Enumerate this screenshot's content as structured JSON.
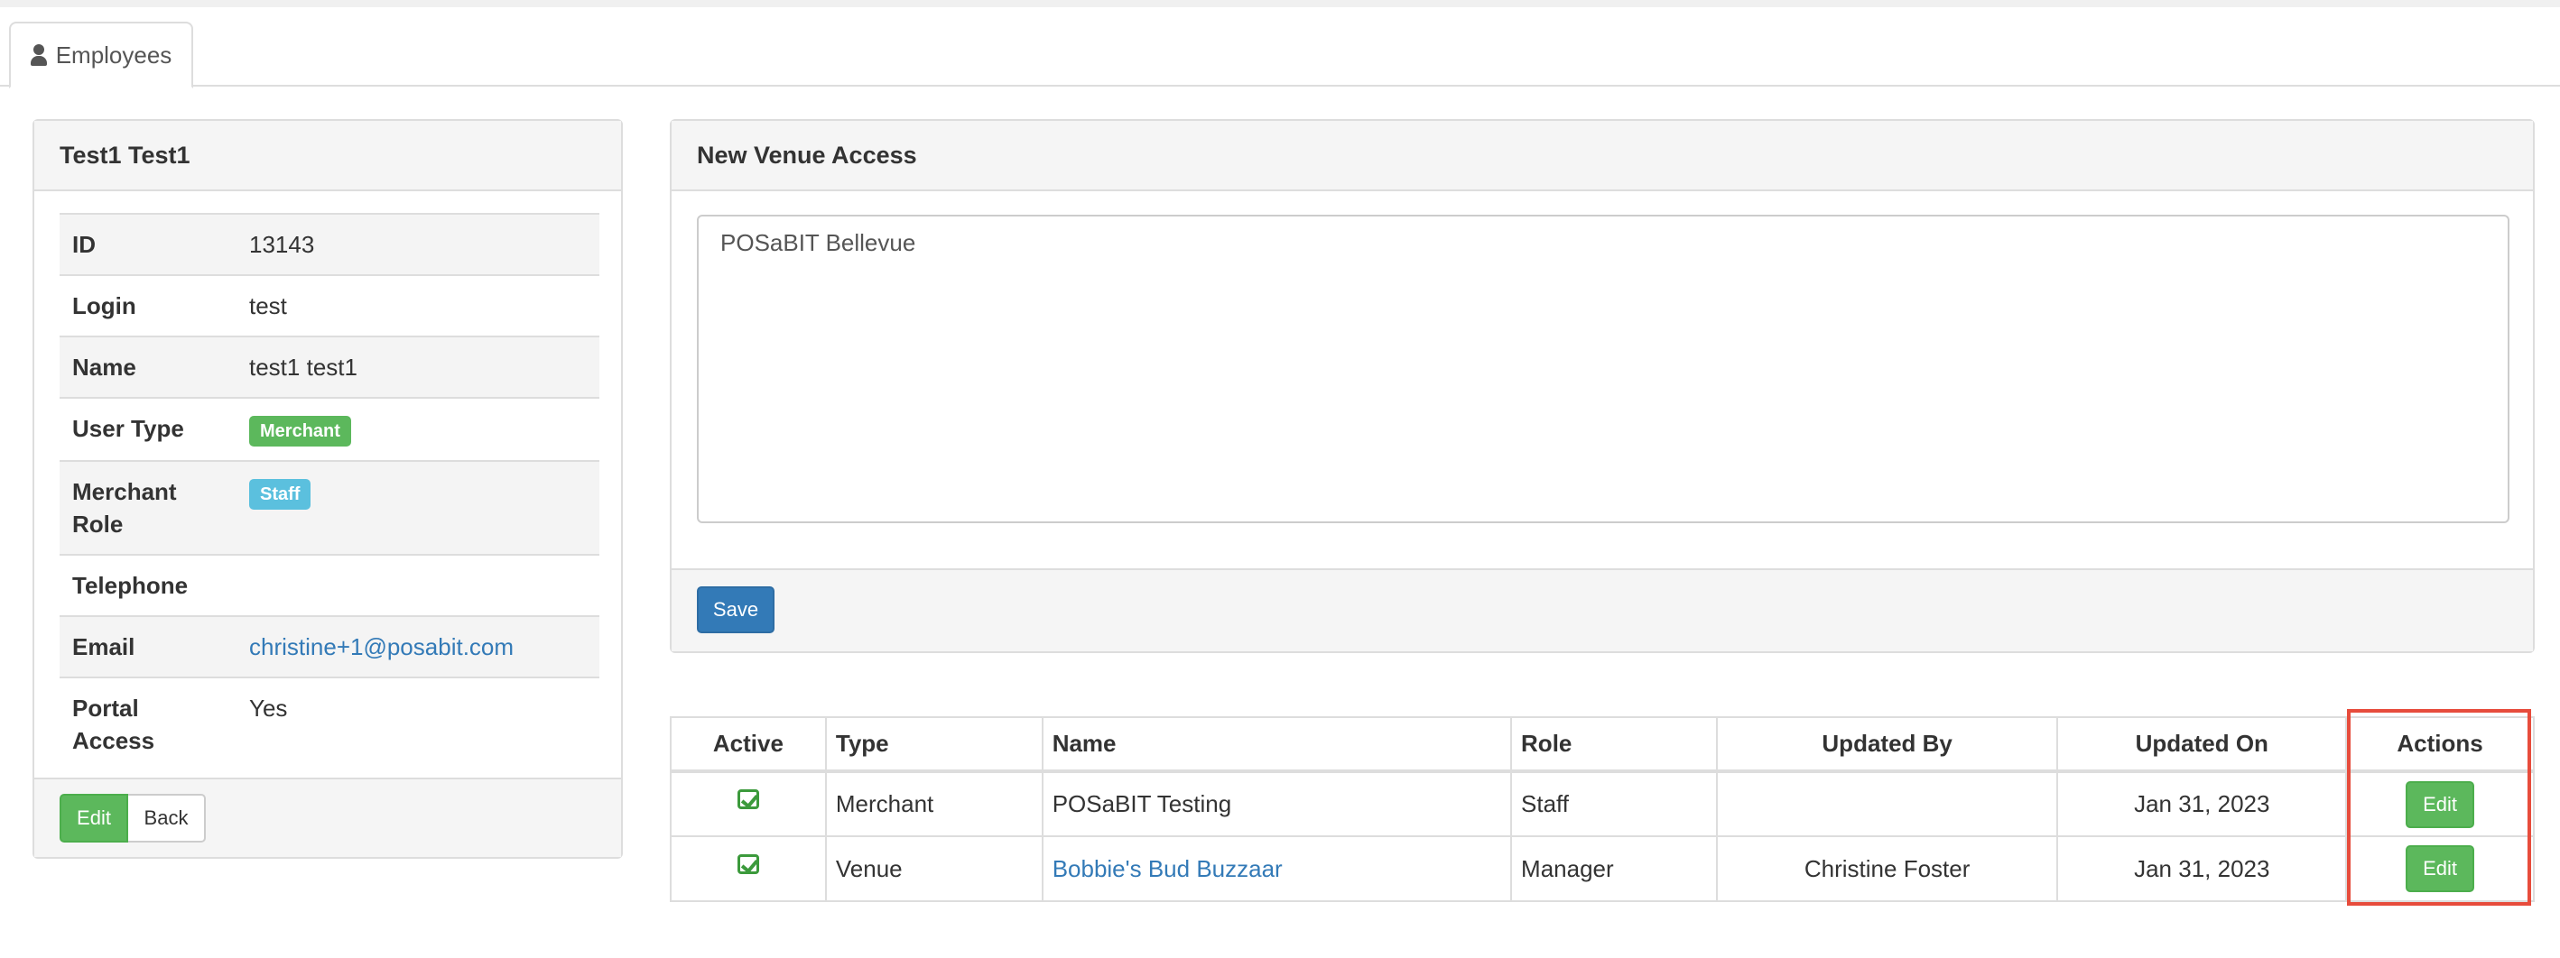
{
  "tabs": [
    {
      "label": "Employees",
      "icon": "user-icon"
    }
  ],
  "employee": {
    "title": "Test1 Test1",
    "fields": [
      {
        "key": "ID",
        "value": "13143"
      },
      {
        "key": "Login",
        "value": "test"
      },
      {
        "key": "Name",
        "value": "test1 test1"
      },
      {
        "key": "User Type",
        "badge": "Merchant",
        "badge_color": "#5cb85c"
      },
      {
        "key": "Merchant Role",
        "badge": "Staff",
        "badge_color": "#5bc0de"
      },
      {
        "key": "Telephone",
        "value": ""
      },
      {
        "key": "Email",
        "link": "christine+1@posabit.com"
      },
      {
        "key": "Portal Access",
        "value": "Yes"
      }
    ],
    "edit_label": "Edit",
    "back_label": "Back"
  },
  "venue_access": {
    "title": "New Venue Access",
    "value": "POSaBIT Bellevue",
    "save_label": "Save"
  },
  "table": {
    "headers": [
      "Active",
      "Type",
      "Name",
      "Role",
      "Updated By",
      "Updated On",
      "Actions"
    ],
    "rows": [
      {
        "active": true,
        "type": "Merchant",
        "name": "POSaBIT Testing",
        "name_is_link": false,
        "role": "Staff",
        "updated_by": "",
        "updated_on": "Jan 31, 2023",
        "action": "Edit"
      },
      {
        "active": true,
        "type": "Venue",
        "name": "Bobbie's Bud Buzzaar",
        "name_is_link": true,
        "role": "Manager",
        "updated_by": "Christine Foster",
        "updated_on": "Jan 31, 2023",
        "action": "Edit"
      }
    ]
  },
  "colors": {
    "primary": "#337ab7",
    "success": "#5cb85c",
    "info": "#5bc0de",
    "highlight": "#e74c3c"
  }
}
